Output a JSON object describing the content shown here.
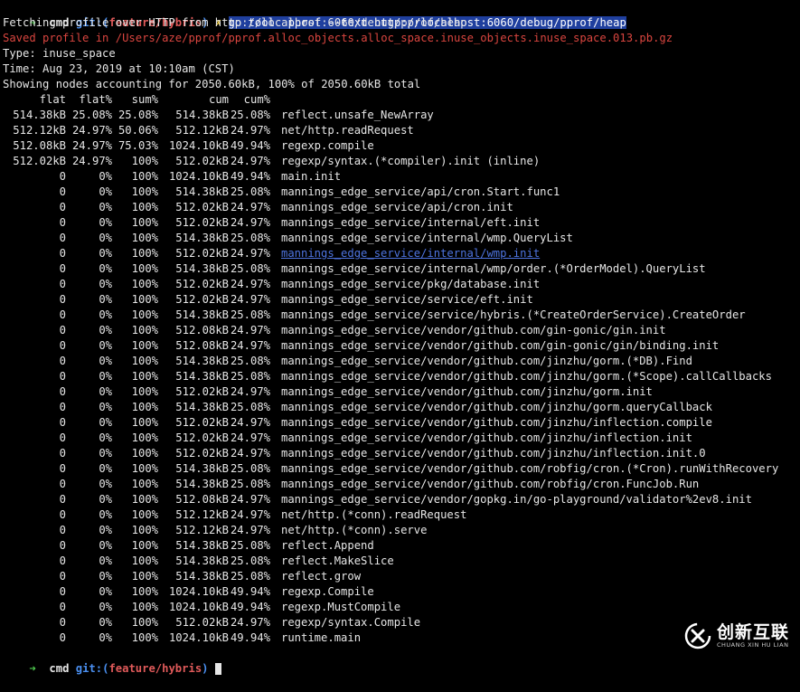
{
  "prompt1": {
    "arrow": "➜",
    "dir": "cmd",
    "git_label": "git:(",
    "branch": "feature/hybris",
    "git_close": ")",
    "mark": "✗",
    "command": "go tool  pprof --text http://localhost:6060/debug/pprof/heap"
  },
  "output": {
    "fetching": "Fetching profile over HTTP from http://localhost:6060/debug/pprof/heap",
    "saved": "Saved profile in /Users/aze/pprof/pprof.alloc_objects.alloc_space.inuse_objects.inuse_space.013.pb.gz",
    "type": "Type: inuse_space",
    "time": "Time: Aug 23, 2019 at 10:10am (CST)",
    "showing": "Showing nodes accounting for 2050.60kB, 100% of 2050.60kB total"
  },
  "table": {
    "headers": [
      "flat",
      "flat%",
      "sum%",
      "cum",
      "cum%"
    ],
    "rows": [
      [
        "514.38kB",
        "25.08%",
        "25.08%",
        "514.38kB",
        "25.08%",
        "reflect.unsafe_NewArray"
      ],
      [
        "512.12kB",
        "24.97%",
        "50.06%",
        "512.12kB",
        "24.97%",
        "net/http.readRequest"
      ],
      [
        "512.08kB",
        "24.97%",
        "75.03%",
        "1024.10kB",
        "49.94%",
        "regexp.compile"
      ],
      [
        "512.02kB",
        "24.97%",
        "100%",
        "512.02kB",
        "24.97%",
        "regexp/syntax.(*compiler).init (inline)"
      ],
      [
        "0",
        "0%",
        "100%",
        "1024.10kB",
        "49.94%",
        "main.init"
      ],
      [
        "0",
        "0%",
        "100%",
        "514.38kB",
        "25.08%",
        "mannings_edge_service/api/cron.Start.func1"
      ],
      [
        "0",
        "0%",
        "100%",
        "512.02kB",
        "24.97%",
        "mannings_edge_service/api/cron.init"
      ],
      [
        "0",
        "0%",
        "100%",
        "512.02kB",
        "24.97%",
        "mannings_edge_service/internal/eft.init"
      ],
      [
        "0",
        "0%",
        "100%",
        "514.38kB",
        "25.08%",
        "mannings_edge_service/internal/wmp.QueryList"
      ],
      [
        "0",
        "0%",
        "100%",
        "512.02kB",
        "24.97%",
        "mannings_edge_service/internal/wmp.init"
      ],
      [
        "0",
        "0%",
        "100%",
        "514.38kB",
        "25.08%",
        "mannings_edge_service/internal/wmp/order.(*OrderModel).QueryList"
      ],
      [
        "0",
        "0%",
        "100%",
        "512.02kB",
        "24.97%",
        "mannings_edge_service/pkg/database.init"
      ],
      [
        "0",
        "0%",
        "100%",
        "512.02kB",
        "24.97%",
        "mannings_edge_service/service/eft.init"
      ],
      [
        "0",
        "0%",
        "100%",
        "514.38kB",
        "25.08%",
        "mannings_edge_service/service/hybris.(*CreateOrderService).CreateOrder"
      ],
      [
        "0",
        "0%",
        "100%",
        "512.08kB",
        "24.97%",
        "mannings_edge_service/vendor/github.com/gin-gonic/gin.init"
      ],
      [
        "0",
        "0%",
        "100%",
        "512.08kB",
        "24.97%",
        "mannings_edge_service/vendor/github.com/gin-gonic/gin/binding.init"
      ],
      [
        "0",
        "0%",
        "100%",
        "514.38kB",
        "25.08%",
        "mannings_edge_service/vendor/github.com/jinzhu/gorm.(*DB).Find"
      ],
      [
        "0",
        "0%",
        "100%",
        "514.38kB",
        "25.08%",
        "mannings_edge_service/vendor/github.com/jinzhu/gorm.(*Scope).callCallbacks"
      ],
      [
        "0",
        "0%",
        "100%",
        "512.02kB",
        "24.97%",
        "mannings_edge_service/vendor/github.com/jinzhu/gorm.init"
      ],
      [
        "0",
        "0%",
        "100%",
        "514.38kB",
        "25.08%",
        "mannings_edge_service/vendor/github.com/jinzhu/gorm.queryCallback"
      ],
      [
        "0",
        "0%",
        "100%",
        "512.02kB",
        "24.97%",
        "mannings_edge_service/vendor/github.com/jinzhu/inflection.compile"
      ],
      [
        "0",
        "0%",
        "100%",
        "512.02kB",
        "24.97%",
        "mannings_edge_service/vendor/github.com/jinzhu/inflection.init"
      ],
      [
        "0",
        "0%",
        "100%",
        "512.02kB",
        "24.97%",
        "mannings_edge_service/vendor/github.com/jinzhu/inflection.init.0"
      ],
      [
        "0",
        "0%",
        "100%",
        "514.38kB",
        "25.08%",
        "mannings_edge_service/vendor/github.com/robfig/cron.(*Cron).runWithRecovery"
      ],
      [
        "0",
        "0%",
        "100%",
        "514.38kB",
        "25.08%",
        "mannings_edge_service/vendor/github.com/robfig/cron.FuncJob.Run"
      ],
      [
        "0",
        "0%",
        "100%",
        "512.08kB",
        "24.97%",
        "mannings_edge_service/vendor/gopkg.in/go-playground/validator%2ev8.init"
      ],
      [
        "0",
        "0%",
        "100%",
        "512.12kB",
        "24.97%",
        "net/http.(*conn).readRequest"
      ],
      [
        "0",
        "0%",
        "100%",
        "512.12kB",
        "24.97%",
        "net/http.(*conn).serve"
      ],
      [
        "0",
        "0%",
        "100%",
        "514.38kB",
        "25.08%",
        "reflect.Append"
      ],
      [
        "0",
        "0%",
        "100%",
        "514.38kB",
        "25.08%",
        "reflect.MakeSlice"
      ],
      [
        "0",
        "0%",
        "100%",
        "514.38kB",
        "25.08%",
        "reflect.grow"
      ],
      [
        "0",
        "0%",
        "100%",
        "1024.10kB",
        "49.94%",
        "regexp.Compile"
      ],
      [
        "0",
        "0%",
        "100%",
        "1024.10kB",
        "49.94%",
        "regexp.MustCompile"
      ],
      [
        "0",
        "0%",
        "100%",
        "512.02kB",
        "24.97%",
        "regexp/syntax.Compile"
      ],
      [
        "0",
        "0%",
        "100%",
        "1024.10kB",
        "49.94%",
        "runtime.main"
      ]
    ],
    "highlighted_row": 9
  },
  "prompt2": {
    "arrow": "➜",
    "dir": "cmd",
    "git_label": "git:(",
    "branch": "feature/hybris",
    "git_close": ")"
  },
  "watermark": {
    "cn": "创新互联",
    "en": "CHUANG XIN HU LIAN"
  },
  "colors": {
    "background": "#000000",
    "text": "#e6e6e6",
    "prompt_arrow": "#4ec94e",
    "git_label": "#4a8ff0",
    "branch": "#e05a5a",
    "dirty_mark": "#f2d14a",
    "selection": "#1f3f9e",
    "error_text": "#d9453f",
    "link_text": "#4e74e0"
  }
}
